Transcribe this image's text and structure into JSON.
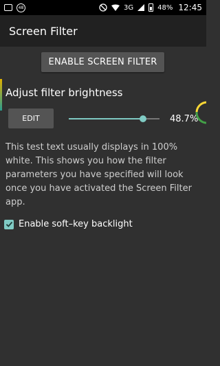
{
  "status_bar": {
    "notification_badge": "48",
    "network": "3G",
    "battery": "48%",
    "time": "12:45"
  },
  "app": {
    "title": "Screen Filter"
  },
  "main": {
    "enable_button_label": "ENABLE SCREEN FILTER",
    "section_title": "Adjust filter brightness",
    "edit_button_label": "EDIT",
    "brightness_percent_label": "48.7%",
    "brightness_value": 0.82,
    "description": "This test text usually displays in 100% white. This shows you how the filter parameters you have specified will look once you have activated the Screen Filter app.",
    "checkbox_label": "Enable soft–key backlight",
    "checkbox_checked": true
  },
  "colors": {
    "background": "#303030",
    "app_bar": "#212121",
    "button": "#545454",
    "accent": "#80cbc4"
  },
  "icons": {
    "status_left": [
      "message-icon",
      "badge-icon"
    ],
    "status_right": [
      "do-not-disturb-icon",
      "wifi-icon",
      "signal-icon",
      "battery-icon"
    ],
    "checkbox": "check-icon"
  }
}
